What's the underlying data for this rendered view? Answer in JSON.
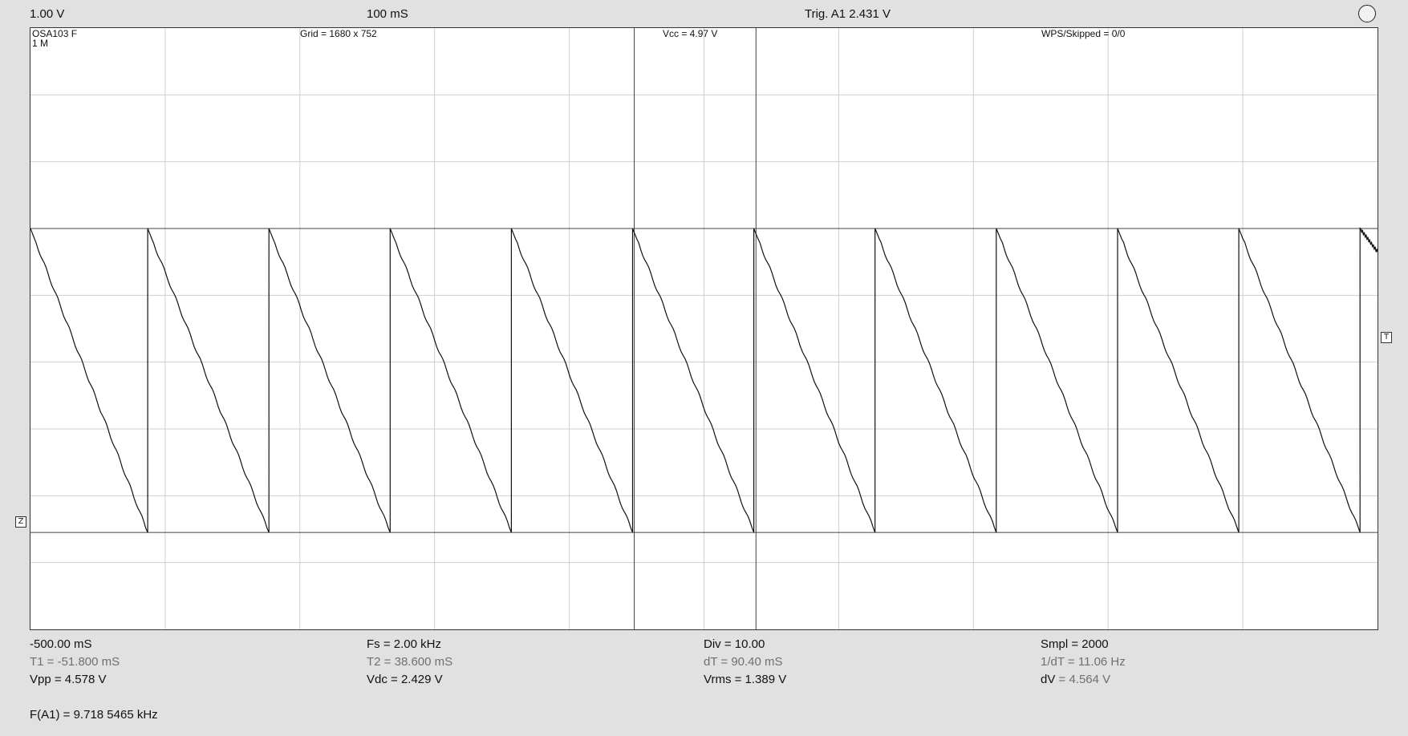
{
  "header": {
    "volts_per_div": "1.00 V",
    "time_per_div": "100 mS",
    "trigger": "Trig. A1  2.431 V"
  },
  "screen": {
    "device": "OSA103 F",
    "depth": "1 M",
    "grid": "Grid = 1680 x 752",
    "vcc": "Vcc = 4.97 V",
    "wps": "WPS/Skipped  = 0/0",
    "grid_divisions": {
      "x": 10,
      "y": 9
    },
    "trace_color": "#111111",
    "grid_color": "#cfcfcf"
  },
  "markers": {
    "ground": "Z",
    "trigger": "T"
  },
  "measurements": {
    "row1": [
      "-500.00 mS",
      "Fs = 2.00 kHz",
      "Div = 10.00",
      "Smpl = 2000"
    ],
    "row2": [
      "T1 = -51.800 mS",
      "T2 = 38.600 mS",
      "dT = 90.40 mS",
      "1/dT = 11.06 Hz"
    ],
    "row3": [
      "Vpp = 4.578 V",
      "Vdc = 2.429 V",
      "Vrms = 1.389 V"
    ],
    "dv_name": "dV",
    "dv_value": " = 4.564 V",
    "frequency": "F(A1) = 9.718 5465 kHz"
  },
  "chart_data": {
    "type": "line",
    "series": [
      {
        "values_description_free": true,
        "x": [
          -500,
          -413,
          -413,
          -323,
          -323,
          -233,
          -233,
          -143,
          -143,
          -53,
          -53,
          37,
          37,
          127,
          127,
          217,
          217,
          307,
          307,
          397,
          397,
          487,
          487,
          500
        ],
        "y": [
          4.55,
          0.0,
          4.55,
          0.0,
          4.55,
          0.0,
          4.55,
          0.0,
          4.55,
          0.0,
          4.55,
          0.0,
          4.55,
          0.0,
          4.55,
          0.0,
          4.55,
          0.0,
          4.55,
          0.0,
          4.55,
          0.0,
          4.55,
          4.2
        ]
      }
    ],
    "xlim": [
      -500,
      500
    ],
    "ylim": [
      -1.45,
      7.55
    ],
    "cursors_x": [
      -51.8,
      38.6
    ],
    "cursors_y": [
      4.55,
      0.0
    ],
    "grid": true
  }
}
